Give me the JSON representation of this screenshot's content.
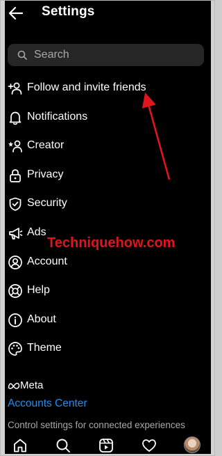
{
  "header": {
    "back_icon": "back-arrow-icon",
    "title": "Settings"
  },
  "search": {
    "icon": "search-icon",
    "placeholder": "Search",
    "value": ""
  },
  "menu": {
    "items": [
      {
        "label": "Follow and invite friends",
        "icon": "add-person-icon"
      },
      {
        "label": "Notifications",
        "icon": "bell-icon"
      },
      {
        "label": "Creator",
        "icon": "creator-icon"
      },
      {
        "label": "Privacy",
        "icon": "lock-icon"
      },
      {
        "label": "Security",
        "icon": "shield-check-icon"
      },
      {
        "label": "Ads",
        "icon": "megaphone-icon"
      },
      {
        "label": "Account",
        "icon": "account-circle-icon"
      },
      {
        "label": "Help",
        "icon": "lifebuoy-icon"
      },
      {
        "label": "About",
        "icon": "info-icon"
      },
      {
        "label": "Theme",
        "icon": "palette-icon"
      }
    ]
  },
  "meta": {
    "wordmark": "Meta",
    "accounts_center": "Accounts Center",
    "description": "Control settings for connected experiences"
  },
  "bottom_nav": {
    "items": [
      "home-icon",
      "search-icon",
      "reels-icon",
      "heart-icon",
      "profile-avatar"
    ]
  },
  "annotation": {
    "watermark": "Techniquehow.com",
    "arrow_color": "#e0141c"
  },
  "colors": {
    "background": "#000000",
    "link": "#1f8df2",
    "muted": "#a8a8a8",
    "search_bg": "#262626"
  }
}
